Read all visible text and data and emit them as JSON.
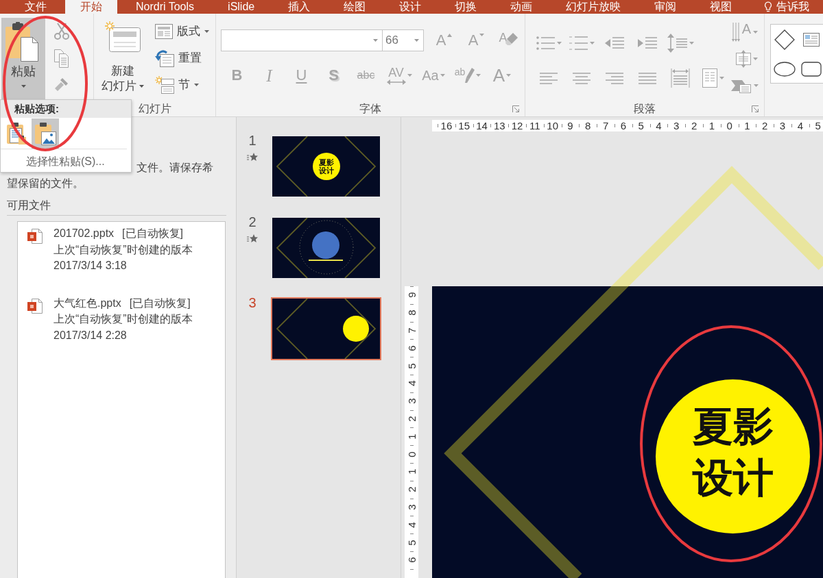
{
  "tabs": [
    {
      "label": "文件",
      "selected": false
    },
    {
      "label": "开始",
      "selected": true
    },
    {
      "label": "Nordri Tools",
      "selected": false
    },
    {
      "label": "iSlide",
      "selected": false
    },
    {
      "label": "插入",
      "selected": false
    },
    {
      "label": "绘图",
      "selected": false
    },
    {
      "label": "设计",
      "selected": false
    },
    {
      "label": "切换",
      "selected": false
    },
    {
      "label": "动画",
      "selected": false
    },
    {
      "label": "幻灯片放映",
      "selected": false
    },
    {
      "label": "审阅",
      "selected": false
    },
    {
      "label": "视图",
      "selected": false
    }
  ],
  "tell_me": {
    "label": "告诉我"
  },
  "ribbon": {
    "clipboard": {
      "paste": {
        "label": "粘贴",
        "pressed": true,
        "dropdown": true,
        "circled": true
      },
      "tools": [
        {
          "kind": "cut",
          "disabled": true
        },
        {
          "kind": "copy",
          "disabled": true
        },
        {
          "kind": "format_painter",
          "disabled": true
        }
      ]
    },
    "slides": {
      "label": "幻灯片",
      "new_slide": {
        "label_lines": [
          "新建",
          "幻灯片"
        ],
        "dropdown": true
      },
      "tools": [
        {
          "kind": "layout",
          "label": "版式",
          "dropdown": true
        },
        {
          "kind": "reset",
          "label": "重置"
        },
        {
          "kind": "section",
          "label": "节",
          "dropdown": true
        }
      ]
    },
    "font": {
      "label": "字体",
      "size": "66",
      "tools": [
        {
          "kind": "grow",
          "glyph": "A",
          "disabled": true
        },
        {
          "kind": "shrink",
          "glyph": "A",
          "disabled": true
        },
        {
          "kind": "clear",
          "glyph": "A",
          "disabled": true
        },
        {
          "kind": "bold",
          "glyph": "B",
          "disabled": true
        },
        {
          "kind": "italic",
          "glyph": "I",
          "disabled": true
        },
        {
          "kind": "underline",
          "glyph": "U",
          "disabled": true
        },
        {
          "kind": "shadow",
          "glyph": "S",
          "disabled": true
        },
        {
          "kind": "strikethrough",
          "glyph": "abc",
          "disabled": true
        },
        {
          "kind": "spacing",
          "glyph": "AV",
          "disabled": true,
          "dropdown": true
        },
        {
          "kind": "case",
          "glyph": "Aa",
          "disabled": true,
          "dropdown": true
        },
        {
          "kind": "highlight",
          "glyph": "ab",
          "disabled": true,
          "dropdown": true
        },
        {
          "kind": "color",
          "glyph": "A",
          "disabled": true,
          "dropdown": true
        }
      ]
    },
    "paragraph": {
      "label": "段落",
      "tools": [
        {
          "kind": "bullets",
          "disabled": true,
          "dropdown": true
        },
        {
          "kind": "numbering",
          "disabled": true,
          "dropdown": true
        },
        {
          "kind": "decrease_indent",
          "disabled": true
        },
        {
          "kind": "increase_indent",
          "disabled": true
        },
        {
          "kind": "line_spacing",
          "disabled": true,
          "dropdown": true
        },
        {
          "kind": "text_direction",
          "glyph": "A",
          "disabled": true,
          "dropdown": true
        },
        {
          "kind": "align_left",
          "disabled": true
        },
        {
          "kind": "align_center",
          "disabled": true
        },
        {
          "kind": "align_right",
          "disabled": true
        },
        {
          "kind": "justify",
          "disabled": true
        },
        {
          "kind": "distribute",
          "disabled": true
        },
        {
          "kind": "columns",
          "disabled": true,
          "dropdown": true
        },
        {
          "kind": "align_text",
          "disabled": true,
          "dropdown": true
        },
        {
          "kind": "smartart",
          "disabled": true,
          "dropdown": true
        }
      ]
    },
    "drawing": {
      "shapes": [
        {
          "kind": "diamond"
        },
        {
          "kind": "text_box"
        },
        {
          "kind": "oval"
        },
        {
          "kind": "rounded_rectangle"
        }
      ]
    }
  },
  "paste_options": {
    "title": "粘贴选项:",
    "options": [
      {
        "kind": "keep_source",
        "selected": false
      },
      {
        "kind": "picture",
        "selected": true
      }
    ],
    "paste_special": "选择性粘贴(S)..."
  },
  "recovery": {
    "message_lines": [
      "文件。请保存希",
      "望保留的文件。"
    ],
    "heading": "可用文件",
    "files": [
      {
        "name": "201702.pptx",
        "status": "[已自动恢复]",
        "description": "上次“自动恢复”时创建的版本",
        "time": "2017/3/14 3:18"
      },
      {
        "name": "大气红色.pptx",
        "status": "[已自动恢复]",
        "description": "上次“自动恢复”时创建的版本",
        "time": "2017/3/14 2:28"
      }
    ]
  },
  "slides": [
    {
      "number": "1",
      "animated": true,
      "selected": false,
      "kind": "title_circle",
      "text": "夏影设计"
    },
    {
      "number": "2",
      "animated": true,
      "selected": false,
      "kind": "ring_circle"
    },
    {
      "number": "3",
      "animated": false,
      "selected": true,
      "kind": "side_circle"
    }
  ],
  "editor": {
    "horizontal_ruler": [
      "16",
      "15",
      "14",
      "13",
      "12",
      "11",
      "10",
      "9",
      "8",
      "7",
      "6",
      "5",
      "4",
      "3",
      "2",
      "1",
      "0",
      "1",
      "2",
      "3",
      "4",
      "5"
    ],
    "vertical_ruler": [
      "9",
      "8",
      "7",
      "6",
      "5",
      "4",
      "3",
      "2",
      "1",
      "0",
      "1",
      "2",
      "3",
      "4",
      "5",
      "6"
    ],
    "slide": {
      "title": "夏影设计",
      "circled": true
    }
  }
}
